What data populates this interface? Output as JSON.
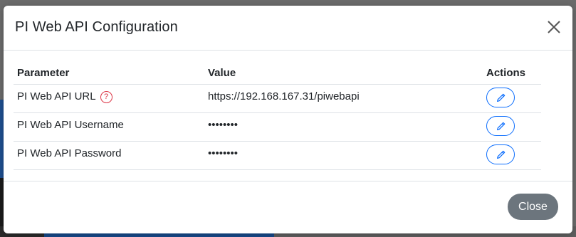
{
  "dialog": {
    "title": "PI Web API Configuration",
    "close_icon": "close-icon"
  },
  "table": {
    "headers": {
      "parameter": "Parameter",
      "value": "Value",
      "actions": "Actions"
    },
    "rows": [
      {
        "parameter": "PI Web API URL",
        "value": "https://192.168.167.31/piwebapi",
        "help_icon": "question-circle-icon",
        "help_text": "?",
        "action_icon": "pencil-icon"
      },
      {
        "parameter": "PI Web API Username",
        "value": "••••••••",
        "action_icon": "pencil-icon"
      },
      {
        "parameter": "PI Web API Password",
        "value": "••••••••",
        "action_icon": "pencil-icon"
      }
    ]
  },
  "footer": {
    "close_label": "Close"
  },
  "colors": {
    "accent": "#0d6efd",
    "help": "#dc3545",
    "secondary_button": "#6c757d"
  }
}
